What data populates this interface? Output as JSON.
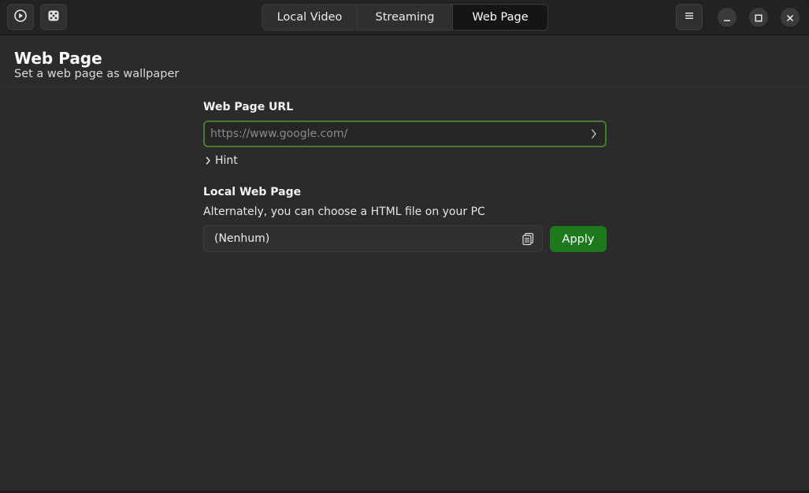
{
  "header": {
    "tabs": [
      {
        "label": "Local Video",
        "active": false
      },
      {
        "label": "Streaming",
        "active": false
      },
      {
        "label": "Web Page",
        "active": true
      }
    ],
    "left_icons": [
      "play-circle-icon",
      "dice-icon"
    ],
    "right_icons": [
      "menu-icon",
      "minimize-icon",
      "maximize-icon",
      "close-icon"
    ]
  },
  "page": {
    "title": "Web Page",
    "subtitle": "Set a web page as wallpaper"
  },
  "url_section": {
    "label": "Web Page URL",
    "input_value": "",
    "input_placeholder": "https://www.google.com/",
    "hint_label": "Hint"
  },
  "local_section": {
    "label": "Local Web Page",
    "description": "Alternately, you can choose a HTML file on your PC",
    "file_value": "(Nenhum)",
    "apply_label": "Apply"
  },
  "colors": {
    "accent_focus": "#4a7a30",
    "apply_button": "#1c7a1c",
    "background": "#2b2b2b",
    "headerbar": "#222222"
  }
}
